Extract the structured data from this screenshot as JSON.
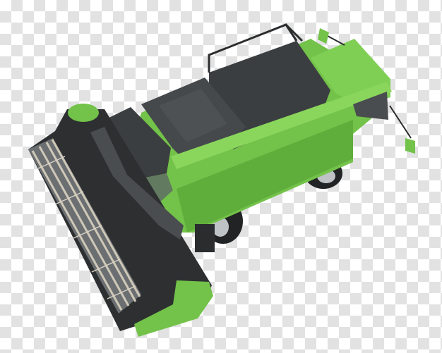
{
  "image": {
    "subject": "combine-harvester",
    "background": "transparency-checkerboard",
    "colors": {
      "body_green": "#73c24a",
      "body_green_light": "#8ad65c",
      "body_green_dark": "#4f9a30",
      "roof_dark": "#3b3e40",
      "roof_mid": "#4a4d50",
      "metal_dark": "#2a2c2e",
      "tire": "#222324",
      "rim": "#bfc3c6",
      "reel_metal": "#cfc8b8",
      "checker_light": "#ffffff",
      "checker_dark": "#e2e2e2"
    }
  }
}
